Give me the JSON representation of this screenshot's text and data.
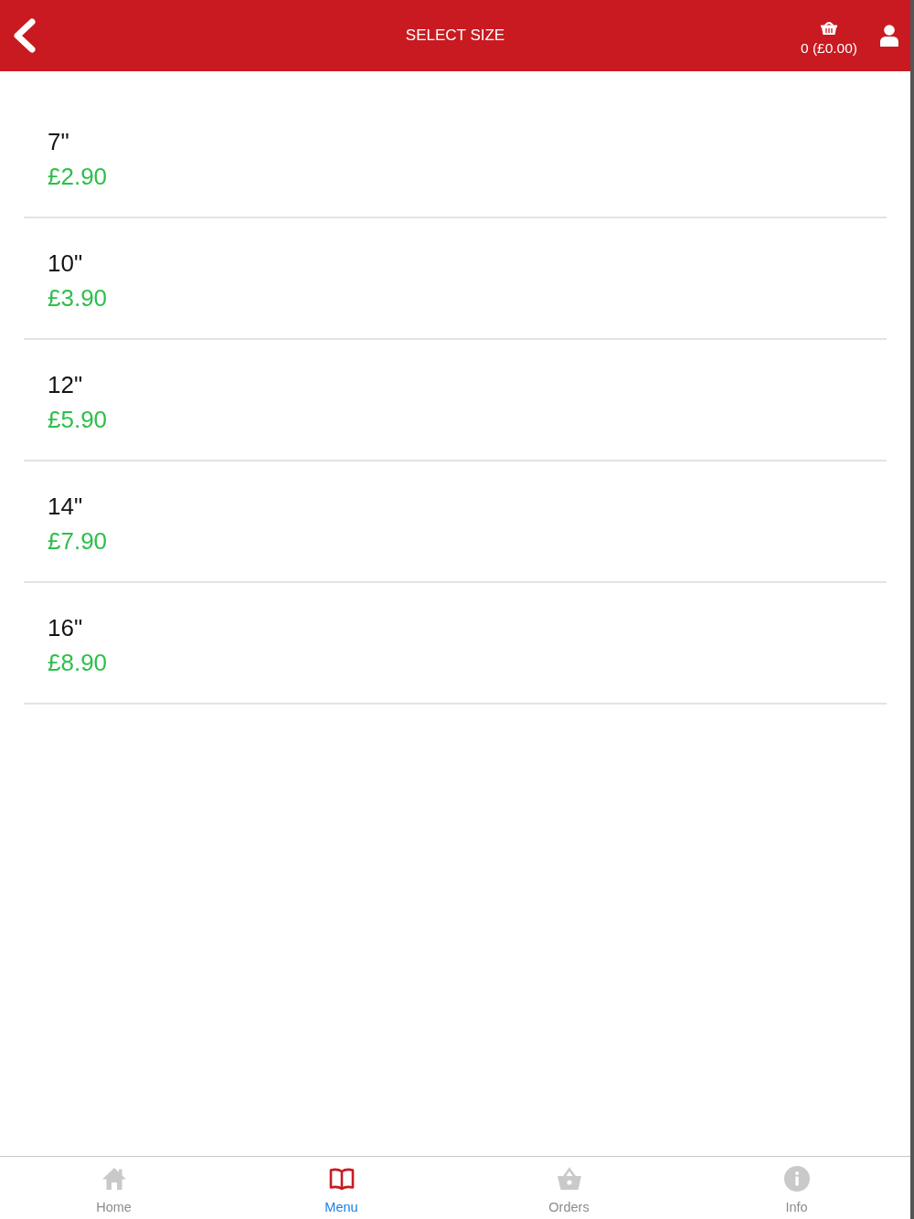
{
  "header": {
    "title": "SELECT SIZE",
    "cart_summary": "0 (£0.00)"
  },
  "sizes": [
    {
      "name": "7\"",
      "price": "£2.90"
    },
    {
      "name": "10\"",
      "price": "£3.90"
    },
    {
      "name": "12\"",
      "price": "£5.90"
    },
    {
      "name": "14\"",
      "price": "£7.90"
    },
    {
      "name": "16\"",
      "price": "£8.90"
    }
  ],
  "tab_bar": [
    {
      "kind": "home",
      "label": "Home",
      "selected": false
    },
    {
      "kind": "menu",
      "label": "Menu",
      "selected": true
    },
    {
      "kind": "orders",
      "label": "Orders",
      "selected": false
    },
    {
      "kind": "info",
      "label": "Info",
      "selected": false
    }
  ]
}
